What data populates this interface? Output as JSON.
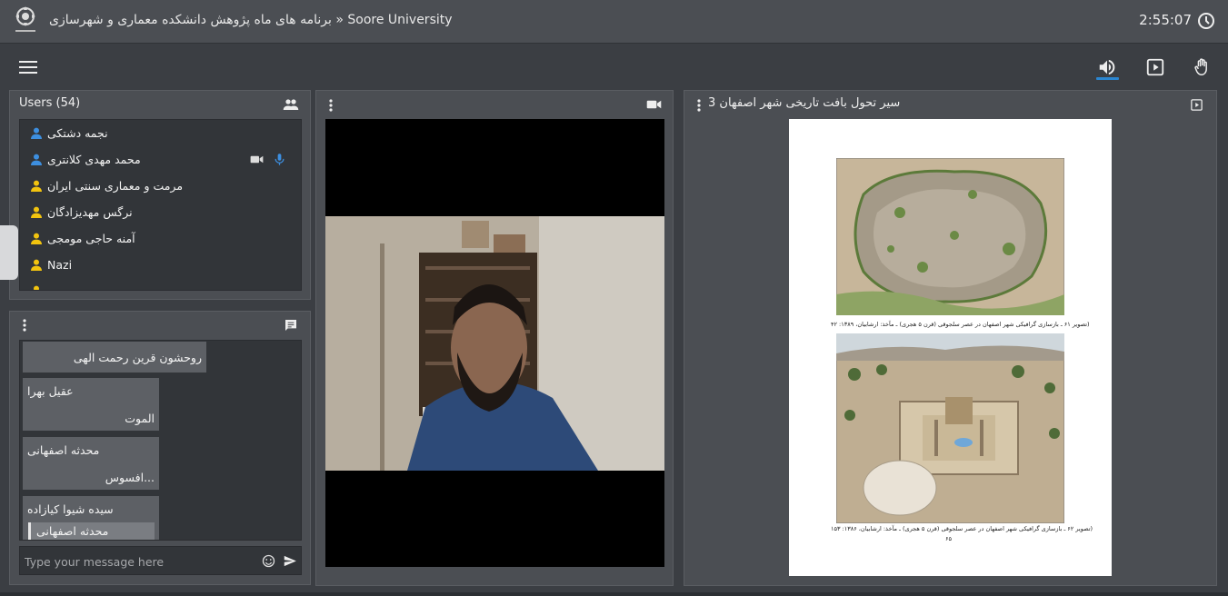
{
  "header": {
    "title": "برنامه های ماه پژوهش دانشکده معماری و شهرسازی » Soore University",
    "clock": "2:55:07"
  },
  "toolbar": {
    "menu_icon": "hamburger-icon",
    "buttons": [
      "volume-icon",
      "presentation-icon",
      "raise-hand-icon"
    ],
    "active": "volume-icon",
    "accent_color": "#2b86d1"
  },
  "users": {
    "title": "Users (54)",
    "items": [
      {
        "name": "نجمه دشتکی",
        "role": "moderator",
        "color": "#3d8fe0"
      },
      {
        "name": "محمد مهدی کلانتری",
        "role": "moderator",
        "color": "#3d8fe0",
        "camera": true,
        "mic": true
      },
      {
        "name": "مرمت و معماری سنتی ایران",
        "role": "viewer",
        "color": "#f2c40f"
      },
      {
        "name": "نرگس مهدیزادگان",
        "role": "viewer",
        "color": "#f2c40f"
      },
      {
        "name": "آمنه حاجی مومجی",
        "role": "viewer",
        "color": "#f2c40f"
      },
      {
        "name": "Nazi",
        "role": "viewer",
        "color": "#f2c40f"
      },
      {
        "name": "...",
        "role": "viewer",
        "color": "#f2c40f"
      }
    ]
  },
  "chat": {
    "messages": [
      {
        "name": "روحشون قرین رحمت الهی",
        "body": ""
      },
      {
        "name": "عقیل بهرا",
        "body": "الموت"
      },
      {
        "name": "محدثه اصفهانی",
        "body": "افسوس..."
      },
      {
        "name": "سیده شیوا کیازاده",
        "quote": "محدثه اصفهانی",
        "body": ""
      }
    ],
    "placeholder": "Type your message here"
  },
  "presentation": {
    "title": "سیر تحول بافت تاریخی شهر اصفهان 3",
    "caption1": "تصویر ۶۱ ـ بازسازی گرافیکی شهر اصفهان در عصر سلجوقی (قرن ۵ هجری) ـ مآخذ: ارشابیان، ۱۳۸۹: ۴۲)",
    "caption2": "تصویر ۶۲ ـ بازسازی گرافیکی شهر اصفهان در عصر سلجوقی (قرن ۵ هجری) ـ مآخذ: ارشابیان، ۱۳۸۶: ۱۵۳)",
    "page": "۶۵"
  }
}
